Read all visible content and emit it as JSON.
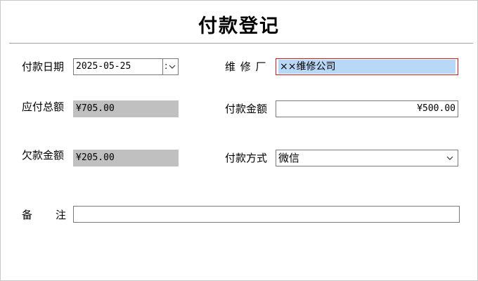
{
  "window": {
    "title": "付款登记"
  },
  "form": {
    "payment_date": {
      "label": "付款日期",
      "value": "2025-05-25"
    },
    "repair_shop": {
      "label": "维 修 厂",
      "value": "××维修公司"
    },
    "total_payable": {
      "label": "应付总额",
      "value": "¥705.00"
    },
    "payment_amount": {
      "label": "付款金额",
      "value": "¥500.00"
    },
    "amount_owed": {
      "label": "欠款金额",
      "value": "¥205.00"
    },
    "payment_method": {
      "label": "付款方式",
      "value": "微信"
    },
    "remarks": {
      "label_left": "备",
      "label_right": "注",
      "value": ""
    }
  },
  "icons": {
    "dropdown": "chevron-down-icon"
  },
  "colors": {
    "readonly_bg": "#c0c0c0",
    "selection_bg": "#b9d7f6",
    "focus_border": "#d01a1a"
  }
}
